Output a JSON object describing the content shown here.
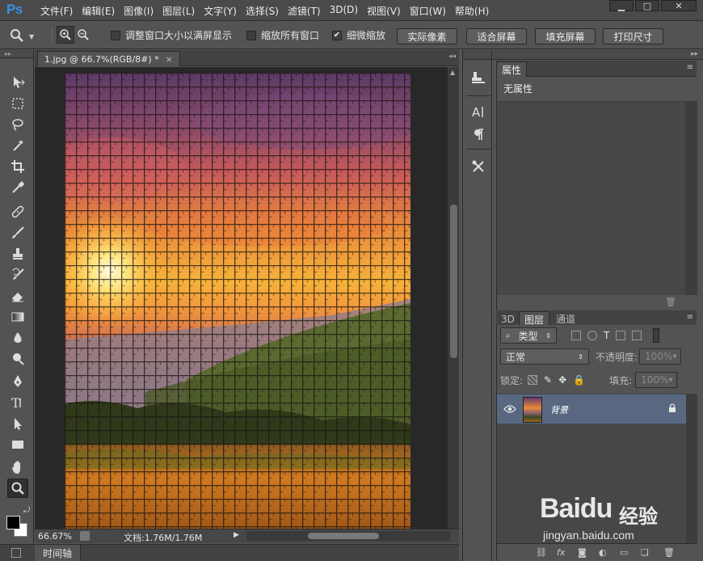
{
  "app": {
    "logo": "Ps",
    "menu": [
      "文件(F)",
      "编辑(E)",
      "图像(I)",
      "图层(L)",
      "文字(Y)",
      "选择(S)",
      "滤镜(T)",
      "3D(D)",
      "视图(V)",
      "窗口(W)",
      "帮助(H)"
    ],
    "window_controls": {
      "minimize": "▁",
      "maximize": "□",
      "close": "✕"
    }
  },
  "options": {
    "resize_windows_label": "调整窗口大小以满屏显示",
    "zoom_all_label": "缩放所有窗口",
    "scrubby_zoom_label": "细微缩放",
    "scrubby_zoom_checked": true,
    "actual_pixels": "实际像素",
    "fit_screen": "适合屏幕",
    "fill_screen": "填充屏幕",
    "print_size": "打印尺寸"
  },
  "document": {
    "tab_title": "1.jpg @ 66.7%(RGB/8#) *",
    "tab_close": "×",
    "zoom": "66.67%",
    "info": "文档:1.76M/1.76M"
  },
  "timeline_label": "时间轴",
  "properties": {
    "tab": "属性",
    "empty_text": "无属性"
  },
  "layers": {
    "tabs": [
      "3D",
      "图层",
      "通道"
    ],
    "active_tab": "图层",
    "filter_kind": "类型",
    "blend_mode": "正常",
    "opacity_label": "不透明度:",
    "opacity_value": "100%",
    "lock_label": "锁定:",
    "fill_label": "填充:",
    "fill_value": "100%",
    "items": [
      {
        "name": "背景",
        "visible": true,
        "locked": true
      }
    ]
  },
  "watermark": {
    "brand": "Baidu",
    "product": "经验",
    "url": "jingyan.baidu.com"
  },
  "colors": {
    "accent_logo": "#3b8fe8",
    "selected_layer": "#596880",
    "panel_bg": "#535353"
  }
}
